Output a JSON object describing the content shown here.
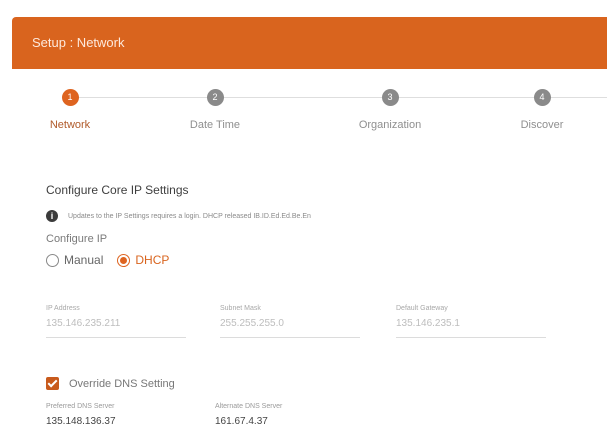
{
  "header": {
    "title": "Setup : Network",
    "color": "#d9641e"
  },
  "steps": [
    {
      "number": "1",
      "label": "Network",
      "active": true
    },
    {
      "number": "2",
      "label": "Date Time",
      "active": false
    },
    {
      "number": "3",
      "label": "Organization",
      "active": false
    },
    {
      "number": "4",
      "label": "Discover",
      "active": false
    }
  ],
  "section": {
    "title": "Configure Core IP Settings",
    "info": "Updates to the IP Settings requires a login. DHCP released IB.ID.Ed.Ed.Be.En"
  },
  "configure_ip": {
    "label": "Configure IP",
    "options": [
      {
        "label": "Manual",
        "checked": false
      },
      {
        "label": "DHCP",
        "checked": true
      }
    ]
  },
  "ip_fields": [
    {
      "label": "IP Address",
      "value": "135.146.235.211"
    },
    {
      "label": "Subnet Mask",
      "value": "255.255.255.0"
    },
    {
      "label": "Default Gateway",
      "value": "135.146.235.1"
    }
  ],
  "dns": {
    "override_label": "Override DNS Setting",
    "checked": true,
    "fields": [
      {
        "label": "Preferred DNS Server",
        "value": "135.148.136.37"
      },
      {
        "label": "Alternate DNS Server",
        "value": "161.67.4.37"
      }
    ]
  },
  "colors": {
    "accent": "#de6420",
    "step_inactive": "#8a8a8a"
  }
}
